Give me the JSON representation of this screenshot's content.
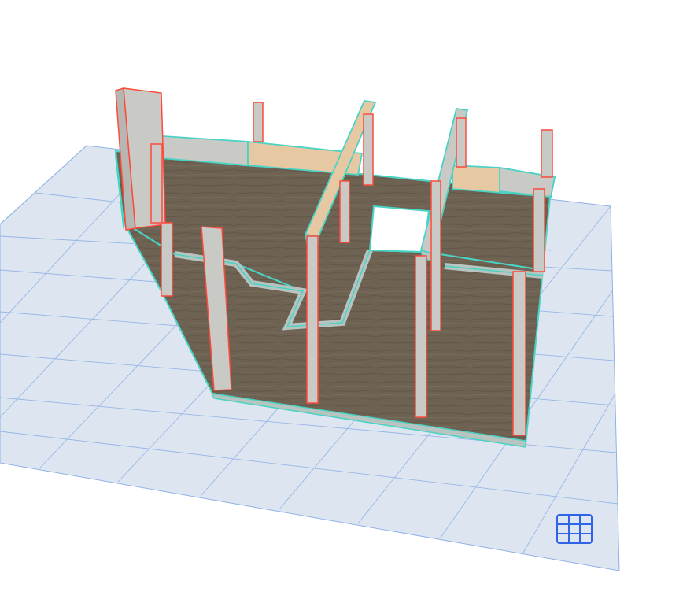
{
  "viewport": {
    "view": "3D",
    "background_color": "#ffffff"
  },
  "colors": {
    "grid_fill": "#dde6f0",
    "grid_line": "#8fb1e6",
    "floor": "#6e6253",
    "floor_dark": "#5d5246",
    "slab_edge": "#b7c4bf",
    "concrete": "#c9cac6",
    "concrete_dark": "#b6b7b3",
    "timber": "#e6c8a2",
    "selection_outline": "#49d3c4",
    "column_edge": "#ff4a3a",
    "grid_icon": "#2f63e8"
  },
  "icons": {
    "grid_toggle": "grid-icon"
  }
}
